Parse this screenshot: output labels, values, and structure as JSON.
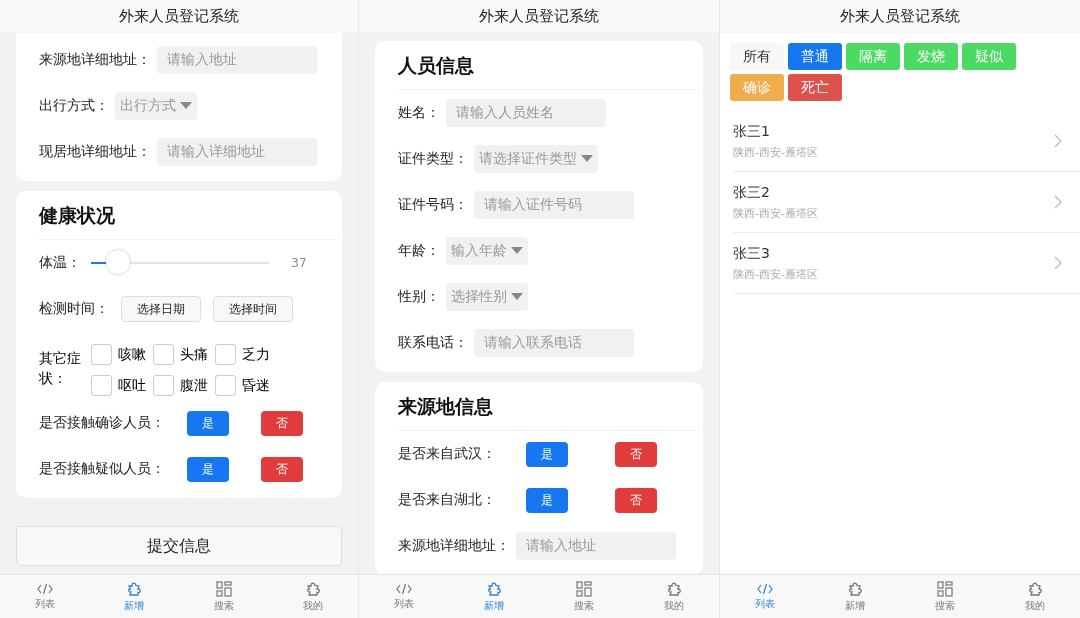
{
  "screens": [
    {
      "kind": "form",
      "title": "外来人员登记系统",
      "sections": [
        {
          "rows": [
            {
              "kind": "input",
              "label": "来源地详细地址：",
              "placeholder": "请输入地址"
            },
            {
              "kind": "select",
              "label": "出行方式：",
              "placeholder": "出行方式"
            },
            {
              "kind": "input",
              "label": "现居地详细地址：",
              "placeholder": "请输入详细地址"
            }
          ]
        },
        {
          "heading": "健康状况",
          "rows": [
            {
              "kind": "slider",
              "label": "体温：",
              "level": 0.15,
              "reading": "37"
            },
            {
              "kind": "buttons",
              "label": "检测时间：",
              "buttons": [
                "选择日期",
                "选择时间"
              ]
            },
            {
              "kind": "checks",
              "label": "其它症状：",
              "options": [
                {
                  "label": "咳嗽",
                  "checked": false
                },
                {
                  "label": "头痛",
                  "checked": false
                },
                {
                  "label": "乏力",
                  "checked": false
                },
                {
                  "label": "呕吐",
                  "checked": false
                },
                {
                  "label": "腹泄",
                  "checked": false
                },
                {
                  "label": "昏迷",
                  "checked": false
                }
              ]
            },
            {
              "kind": "choice",
              "label": "是否接触确诊人员：",
              "options": [
                {
                  "label": "是",
                  "kind": "yes"
                },
                {
                  "label": "否",
                  "kind": "no"
                }
              ]
            },
            {
              "kind": "choice",
              "label": "是否接触疑似人员：",
              "options": [
                {
                  "label": "是",
                  "kind": "yes"
                },
                {
                  "label": "否",
                  "kind": "no"
                }
              ]
            }
          ]
        }
      ],
      "submit": "提交信息",
      "tabs": [
        {
          "label": "列表",
          "selected": false
        },
        {
          "label": "新增",
          "selected": true
        },
        {
          "label": "搜索",
          "selected": false
        },
        {
          "label": "我的",
          "selected": false
        }
      ]
    },
    {
      "kind": "form",
      "title": "外来人员登记系统",
      "sections": [
        {
          "heading": "人员信息",
          "rows": [
            {
              "kind": "input",
              "label": "姓名：",
              "placeholder": "请输入人员姓名"
            },
            {
              "kind": "select",
              "label": "证件类型：",
              "placeholder": "请选择证件类型"
            },
            {
              "kind": "input",
              "label": "证件号码：",
              "placeholder": "请输入证件号码"
            },
            {
              "kind": "select",
              "label": "年龄：",
              "placeholder": "输入年龄"
            },
            {
              "kind": "select",
              "label": "性别：",
              "placeholder": "选择性别"
            },
            {
              "kind": "input",
              "label": "联系电话：",
              "placeholder": "请输入联系电话"
            }
          ]
        },
        {
          "heading": "来源地信息",
          "rows": [
            {
              "kind": "choice",
              "label": "是否来自武汉：",
              "options": [
                {
                  "label": "是",
                  "kind": "yes"
                },
                {
                  "label": "否",
                  "kind": "no"
                }
              ]
            },
            {
              "kind": "choice",
              "label": "是否来自湖北：",
              "options": [
                {
                  "label": "是",
                  "kind": "yes"
                },
                {
                  "label": "否",
                  "kind": "no"
                }
              ]
            },
            {
              "kind": "input",
              "label": "来源地详细地址：",
              "placeholder": "请输入地址"
            }
          ]
        }
      ],
      "tabs": [
        {
          "label": "列表",
          "selected": false
        },
        {
          "label": "新增",
          "selected": true
        },
        {
          "label": "搜索",
          "selected": false
        },
        {
          "label": "我的",
          "selected": false
        }
      ]
    },
    {
      "kind": "list",
      "title": "外来人员登记系统",
      "filters": [
        {
          "label": "所有",
          "color": "#f7f7f7"
        },
        {
          "label": "普通",
          "color": "#1677f0"
        },
        {
          "label": "隔离",
          "color": "#4cd964"
        },
        {
          "label": "发烧",
          "color": "#4cd964"
        },
        {
          "label": "疑似",
          "color": "#4cd964"
        },
        {
          "label": "确诊",
          "color": "#f0ad4e"
        },
        {
          "label": "死亡",
          "color": "#dd524d"
        }
      ],
      "people": [
        {
          "name": "张三1",
          "address": "陕西-西安-雁塔区"
        },
        {
          "name": "张三2",
          "address": "陕西-西安-雁塔区"
        },
        {
          "name": "张三3",
          "address": "陕西-西安-雁塔区"
        }
      ],
      "tabs": [
        {
          "label": "列表",
          "selected": true
        },
        {
          "label": "新增",
          "selected": false
        },
        {
          "label": "搜索",
          "selected": false
        },
        {
          "label": "我的",
          "selected": false
        }
      ]
    }
  ]
}
